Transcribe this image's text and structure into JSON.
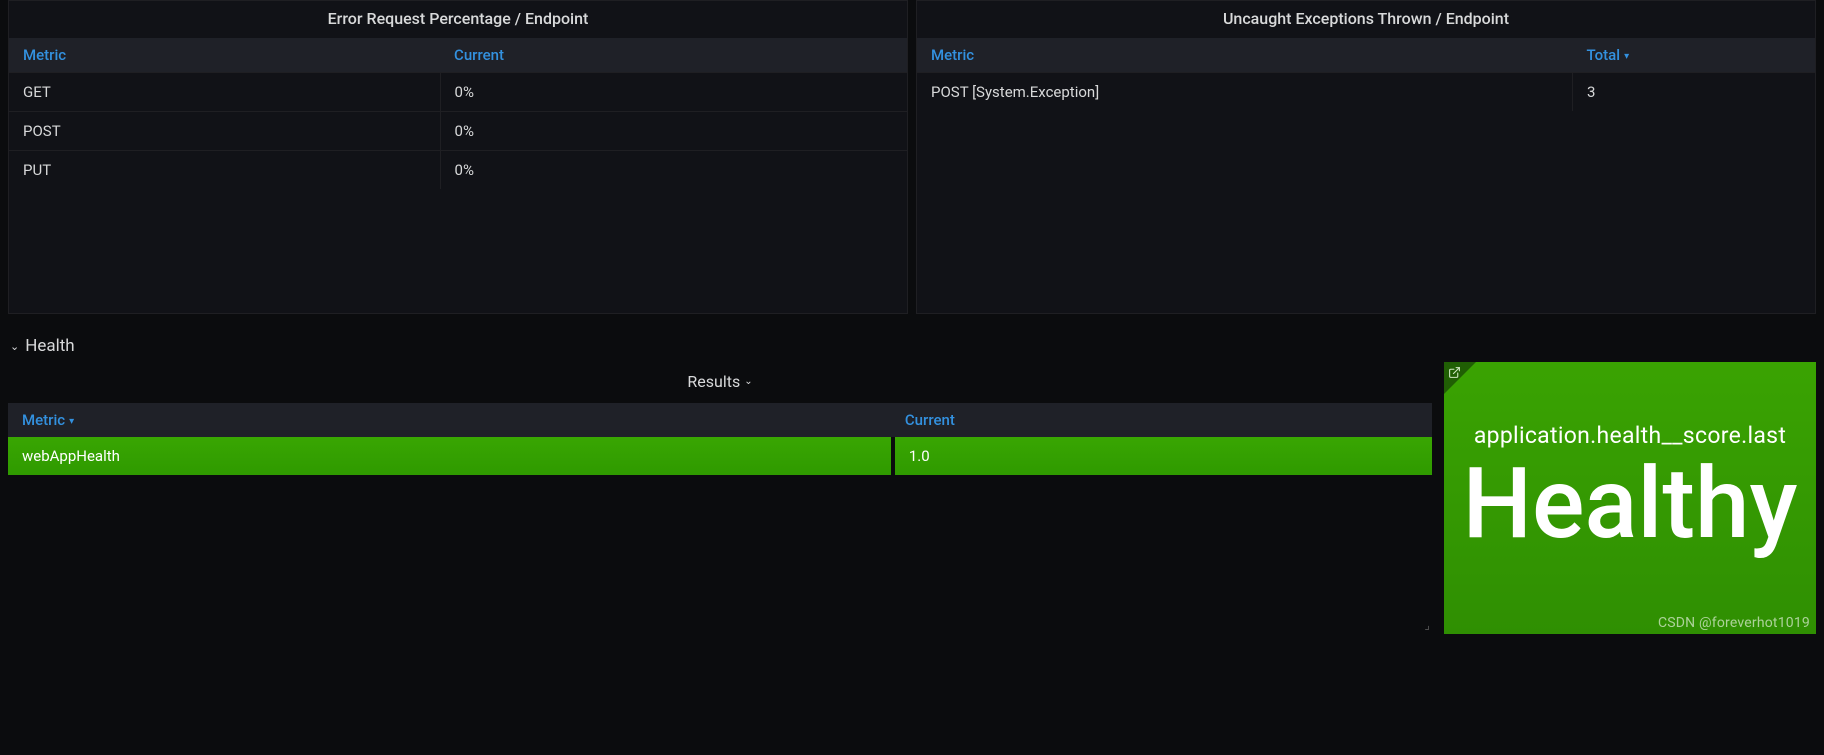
{
  "panels": {
    "errorPct": {
      "title": "Error Request Percentage / Endpoint",
      "columns": [
        "Metric",
        "Current"
      ],
      "rows": [
        {
          "metric": "GET",
          "value": "0%"
        },
        {
          "metric": "POST",
          "value": "0%"
        },
        {
          "metric": "PUT",
          "value": "0%"
        }
      ]
    },
    "exceptions": {
      "title": "Uncaught Exceptions Thrown / Endpoint",
      "columns": [
        "Metric",
        "Total"
      ],
      "rows": [
        {
          "metric": "POST [System.Exception]",
          "value": "3"
        }
      ]
    }
  },
  "section": {
    "label": "Health"
  },
  "results": {
    "title": "Results",
    "columns": [
      "Metric",
      "Current"
    ],
    "rows": [
      {
        "metric": "webAppHealth",
        "value": "1.0"
      }
    ]
  },
  "healthStat": {
    "metric_label": "application.health__score.last",
    "value": "Healthy"
  },
  "watermark": "CSDN @foreverhot1019"
}
